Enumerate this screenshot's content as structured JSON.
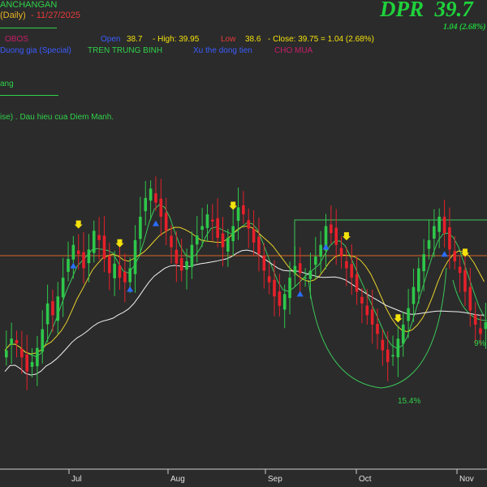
{
  "header": {
    "title": "ANCHANGAN",
    "period": "(Daily)",
    "date": "- 11/27/2025",
    "obscured_left": "OBOS",
    "open_label": "Open",
    "open_value": "38.7",
    "high_text": "- High: 39.95",
    "low_label": "Low",
    "low_value": "38.6",
    "close_text": "- Close: 39.75 = 1.04  (2.68%)",
    "legend_1": "Duong gia (Special)",
    "legend_2": "TREN TRUNG BINH",
    "legend_3": "Xu the dong tien",
    "legend_4": "CHO MUA",
    "trend_label": "ang",
    "signal_text": "ise) . Dau hieu cua Diem Manh."
  },
  "ticker": {
    "symbol": "DPR",
    "price": "39.7",
    "change": "1.04  (2.68%)"
  },
  "annotations": {
    "pct_1": "15.4%",
    "pct_2": "9%"
  },
  "x_axis": {
    "months": [
      "Jul",
      "Aug",
      "Sep",
      "Oct",
      "Nov"
    ]
  },
  "colors": {
    "background": "#2b2b2b",
    "up_candle": "#2ec84a",
    "down_candle": "#e6202a",
    "ticker": "#1fd13b",
    "ma_white": "#f0f0f0",
    "ma_yellow": "#e8d22a",
    "ma_green": "#3cc85a",
    "hline": "#d8642a",
    "signal_down_arrow": "#f3e10c",
    "signal_up_arrow": "#2a6dff"
  },
  "chart_data": {
    "type": "candlestick",
    "months": [
      "Jul",
      "Aug",
      "Sep",
      "Oct",
      "Nov"
    ],
    "series": [
      {
        "name": "Close",
        "values": [
          38.5,
          39.0,
          38.8,
          38.2,
          37.6,
          38.0,
          38.6,
          39.4,
          40.5,
          40.0,
          40.8,
          41.6,
          42.4,
          43.0,
          42.6,
          42.0,
          42.8,
          43.6,
          43.2,
          42.4,
          41.8,
          42.2,
          41.6,
          41.4,
          42.0,
          43.2,
          44.2,
          45.0,
          45.4,
          44.8,
          44.2,
          43.6,
          42.9,
          42.2,
          41.9,
          42.3,
          43.0,
          43.4,
          43.8,
          44.3,
          44.0,
          43.3,
          42.9,
          43.3,
          43.8,
          44.6,
          44.3,
          43.7,
          43.1,
          42.6,
          41.9,
          41.4,
          40.8,
          40.4,
          40.9,
          41.6,
          42.1,
          41.8,
          41.6,
          41.9,
          42.5,
          43.0,
          43.8,
          43.5,
          43.0,
          42.5,
          42.0,
          41.6,
          41.0,
          40.5,
          40.0,
          39.6,
          39.2,
          38.5,
          38.0,
          38.3,
          39.0,
          39.6,
          40.3,
          41.2,
          42.0,
          42.6,
          43.2,
          43.8,
          44.2,
          43.5,
          42.8,
          42.3,
          41.8,
          41.0,
          40.2,
          39.6,
          39.2,
          39.7
        ]
      }
    ]
  }
}
